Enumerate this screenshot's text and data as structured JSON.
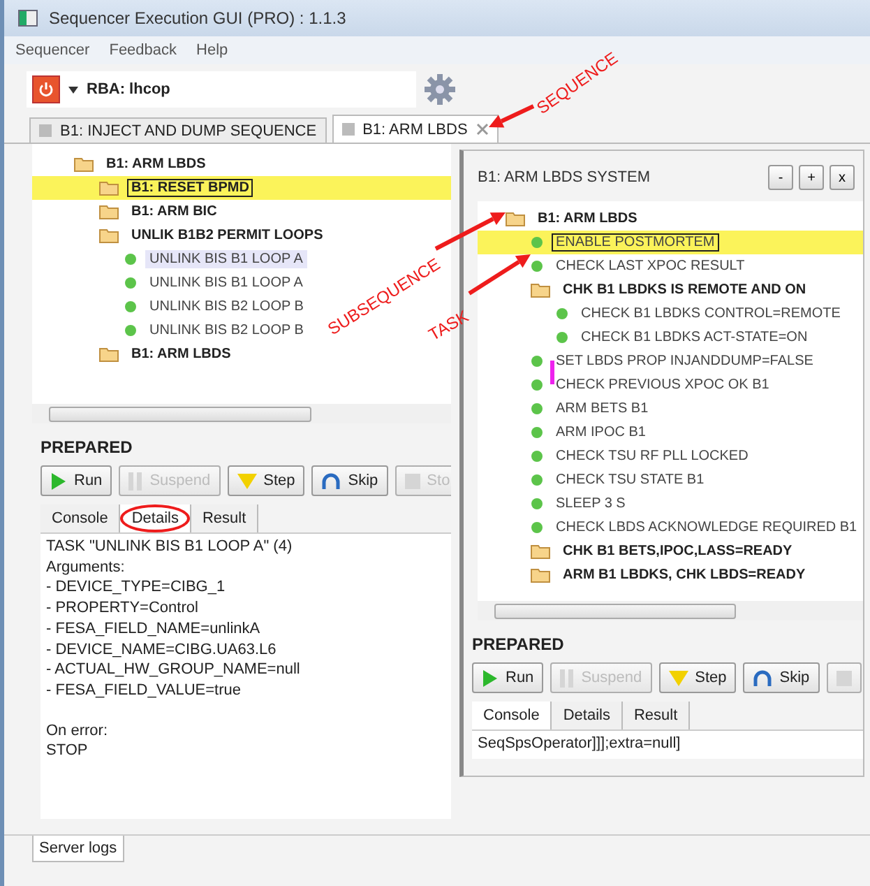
{
  "window": {
    "title": "Sequencer Execution GUI (PRO) : 1.1.3"
  },
  "menu": [
    "Sequencer",
    "Feedback",
    "Help"
  ],
  "toolbar": {
    "rba": "RBA: lhcop"
  },
  "tabs": [
    {
      "label": "B1: INJECT AND DUMP SEQUENCE",
      "selected": false,
      "closable": false
    },
    {
      "label": "B1: ARM LBDS",
      "selected": true,
      "closable": true
    }
  ],
  "left": {
    "tree": [
      {
        "label": "B1: ARM LBDS",
        "kind": "folder",
        "selected": false,
        "focused": false,
        "children": [
          {
            "label": "B1: RESET BPMD",
            "kind": "folder",
            "selected": true,
            "focused": false
          },
          {
            "label": "B1: ARM BIC",
            "kind": "folder",
            "selected": false,
            "focused": false
          },
          {
            "label": "UNLIK B1B2 PERMIT LOOPS",
            "kind": "folder",
            "selected": false,
            "focused": false,
            "children": [
              {
                "label": "UNLINK BIS B1 LOOP A",
                "kind": "task",
                "selected": false,
                "focused": true
              },
              {
                "label": "UNLINK BIS B1 LOOP A",
                "kind": "task",
                "selected": false,
                "focused": false
              },
              {
                "label": "UNLINK BIS B2 LOOP B",
                "kind": "task",
                "selected": false,
                "focused": false
              },
              {
                "label": "UNLINK BIS B2 LOOP B",
                "kind": "task",
                "selected": false,
                "focused": false
              }
            ]
          },
          {
            "label": "B1: ARM LBDS",
            "kind": "folder",
            "selected": false,
            "focused": false
          }
        ]
      }
    ],
    "status": "PREPARED",
    "buttons": [
      {
        "label": "Run",
        "kind": "run",
        "disabled": false
      },
      {
        "label": "Suspend",
        "kind": "suspend",
        "disabled": true
      },
      {
        "label": "Step",
        "kind": "step",
        "disabled": false
      },
      {
        "label": "Skip",
        "kind": "skip",
        "disabled": false
      },
      {
        "label": "Sto",
        "kind": "stop",
        "disabled": true
      }
    ],
    "output_tabs": [
      {
        "label": "Console",
        "selected": false
      },
      {
        "label": "Details",
        "selected": true
      },
      {
        "label": "Result",
        "selected": false
      }
    ],
    "output": [
      [
        "TASK \"UNLINK BIS B1 LOOP A\" (4)",
        "Arguments:",
        "- DEVICE_TYPE=CIBG_1",
        "- PROPERTY=Control",
        "- FESA_FIELD_NAME=unlinkA",
        "- DEVICE_NAME=CIBG.UA63.L6",
        "- ACTUAL_HW_GROUP_NAME=null",
        "- FESA_FIELD_VALUE=true"
      ],
      [
        "On error:",
        "STOP"
      ]
    ]
  },
  "right": {
    "title": "B1: ARM LBDS SYSTEM",
    "window_buttons": [
      "-",
      "+",
      "x"
    ],
    "tree": [
      {
        "label": "B1: ARM LBDS",
        "kind": "folder",
        "selected": false,
        "focused": false,
        "children": [
          {
            "label": "ENABLE POSTMORTEM",
            "kind": "task",
            "selected": true,
            "focused": false
          },
          {
            "label": "CHECK LAST XPOC RESULT",
            "kind": "task",
            "selected": false,
            "focused": false
          },
          {
            "label": "CHK B1 LBDKS IS REMOTE AND ON",
            "kind": "folder",
            "selected": false,
            "focused": false,
            "children": [
              {
                "label": "CHECK B1 LBDKS CONTROL=REMOTE",
                "kind": "task",
                "selected": false,
                "focused": false
              },
              {
                "label": "CHECK B1 LBDKS ACT-STATE=ON",
                "kind": "task",
                "selected": false,
                "focused": false
              }
            ]
          },
          {
            "label": "SET LBDS PROP INJANDDUMP=FALSE",
            "kind": "task",
            "selected": false,
            "focused": false
          },
          {
            "label": "CHECK PREVIOUS XPOC OK B1",
            "kind": "task",
            "selected": false,
            "focused": false
          },
          {
            "label": "ARM BETS B1",
            "kind": "task",
            "selected": false,
            "focused": false
          },
          {
            "label": "ARM IPOC B1",
            "kind": "task",
            "selected": false,
            "focused": false
          },
          {
            "label": "CHECK TSU RF PLL LOCKED",
            "kind": "task",
            "selected": false,
            "focused": false
          },
          {
            "label": "CHECK TSU STATE B1",
            "kind": "task",
            "selected": false,
            "focused": false
          },
          {
            "label": "SLEEP 3 S",
            "kind": "task",
            "selected": false,
            "focused": false
          },
          {
            "label": "CHECK LBDS ACKNOWLEDGE REQUIRED B1",
            "kind": "task",
            "selected": false,
            "focused": false
          },
          {
            "label": "CHK B1 BETS,IPOC,LASS=READY",
            "kind": "folder",
            "selected": false,
            "focused": false
          },
          {
            "label": "ARM B1 LBDKS, CHK LBDS=READY",
            "kind": "folder",
            "selected": false,
            "focused": false
          }
        ]
      }
    ],
    "status": "PREPARED",
    "buttons": [
      {
        "label": "Run",
        "kind": "run",
        "disabled": false
      },
      {
        "label": "Suspend",
        "kind": "suspend",
        "disabled": true
      },
      {
        "label": "Step",
        "kind": "step",
        "disabled": false
      },
      {
        "label": "Skip",
        "kind": "skip",
        "disabled": false
      },
      {
        "kind": "stop",
        "disabled": true
      }
    ],
    "output_tabs": [
      {
        "label": "Console",
        "selected": true
      },
      {
        "label": "Details",
        "selected": false
      },
      {
        "label": "Result",
        "selected": false
      }
    ],
    "output": [
      [
        "SeqSpsOperator]]];extra=null]"
      ]
    ]
  },
  "bottom_tabs": [
    "Server logs"
  ],
  "annotations": [
    {
      "text": "SEQUENCE",
      "kind": "arrow"
    },
    {
      "text": "SUBSEQUENCE",
      "kind": "arrow"
    },
    {
      "text": "TASK",
      "kind": "arrow"
    },
    {
      "kind": "circle"
    },
    {
      "kind": "bar"
    }
  ]
}
